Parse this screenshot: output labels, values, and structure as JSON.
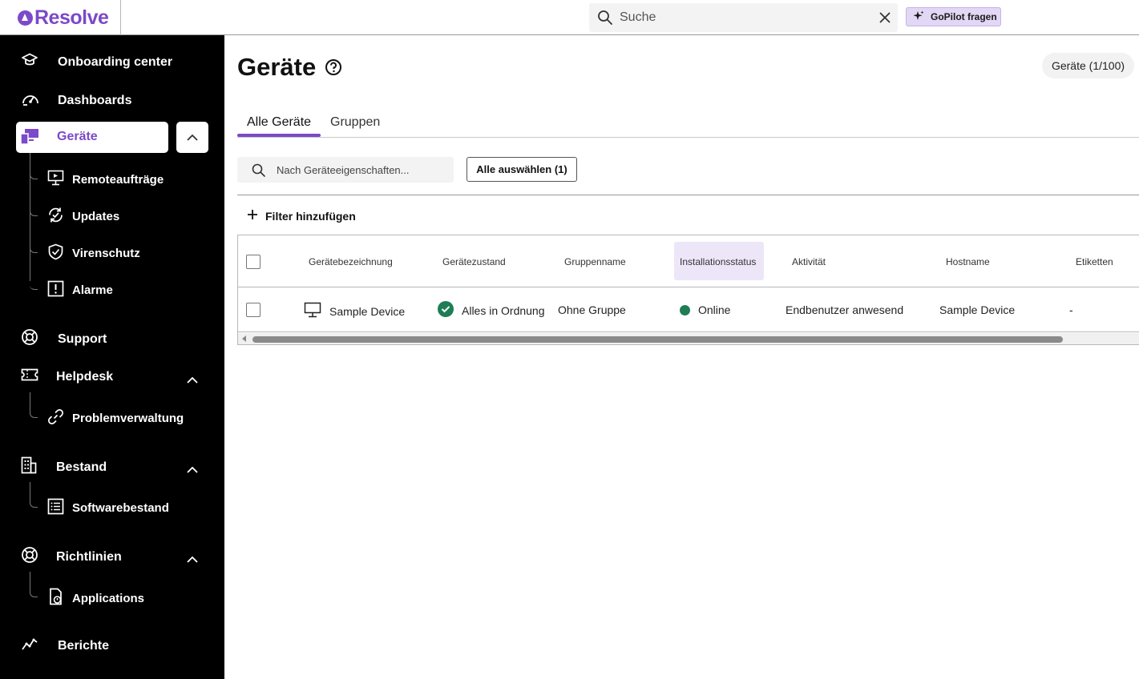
{
  "app": {
    "logo_text": "Resolve",
    "brand_color": "#7b49c9"
  },
  "topbar": {
    "search_placeholder": "Suche",
    "gopilot_label": "GoPilot fragen"
  },
  "sidebar": {
    "items": [
      {
        "label": "Onboarding center",
        "icon": "graduation-cap-icon"
      },
      {
        "label": "Dashboards",
        "icon": "speedometer-icon"
      },
      {
        "label": "Geräte",
        "icon": "devices-icon",
        "active": true
      },
      {
        "label": "Support",
        "icon": "lifebuoy-icon"
      },
      {
        "label": "Helpdesk",
        "icon": "ticket-icon"
      },
      {
        "label": "Bestand",
        "icon": "building-icon"
      },
      {
        "label": "Richtlinien",
        "icon": "lifebuoy-icon"
      },
      {
        "label": "Berichte",
        "icon": "line-chart-icon"
      }
    ],
    "geraete_sub": [
      {
        "label": "Remoteaufträge",
        "icon": "monitor-play-icon"
      },
      {
        "label": "Updates",
        "icon": "refresh-check-icon"
      },
      {
        "label": "Virenschutz",
        "icon": "shield-check-icon"
      },
      {
        "label": "Alarme",
        "icon": "alert-square-icon"
      }
    ],
    "helpdesk_sub": [
      {
        "label": "Problemverwaltung",
        "icon": "link-icon"
      }
    ],
    "bestand_sub": [
      {
        "label": "Softwarebestand",
        "icon": "list-icon"
      }
    ],
    "richtlinien_sub": [
      {
        "label": "Applications",
        "icon": "app-file-icon"
      }
    ]
  },
  "main": {
    "title": "Geräte",
    "count_badge": "Geräte (1/100)",
    "tabs": [
      {
        "label": "Alle Geräte",
        "active": true
      },
      {
        "label": "Gruppen"
      }
    ],
    "filter_placeholder": "Nach Geräteeigenschaften...",
    "select_all_label": "Alle auswählen (1)",
    "add_filter_label": "Filter hinzufügen",
    "table": {
      "columns": [
        "Gerätebezeichnung",
        "Gerätezustand",
        "Gruppenname",
        "Installationsstatus",
        "Aktivität",
        "Hostname",
        "Etiketten"
      ],
      "rows": [
        {
          "device_name": "Sample Device",
          "state": "Alles in Ordnung",
          "group": "Ohne Gruppe",
          "install_status": "Online",
          "activity": "Endbenutzer anwesend",
          "hostname": "Sample Device",
          "labels": "-"
        }
      ]
    }
  }
}
